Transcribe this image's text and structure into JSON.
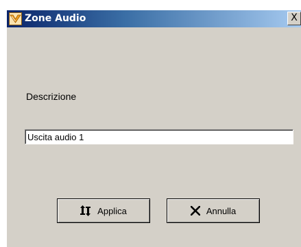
{
  "window": {
    "title": "Zone Audio",
    "close_glyph": "X"
  },
  "form": {
    "description_label": "Descrizione",
    "description_value": "Uscita audio 1"
  },
  "buttons": {
    "apply_label": "Applica",
    "apply_icon": "apply-arrows-icon",
    "cancel_label": "Annulla",
    "cancel_icon": "close-x-icon"
  },
  "icons": {
    "app": "zone-audio-app-icon"
  },
  "colors": {
    "titlebar_start": "#0a246a",
    "titlebar_end": "#a6caf0",
    "window_bg": "#d4d0c8",
    "app_icon_orange": "#f0a020"
  }
}
